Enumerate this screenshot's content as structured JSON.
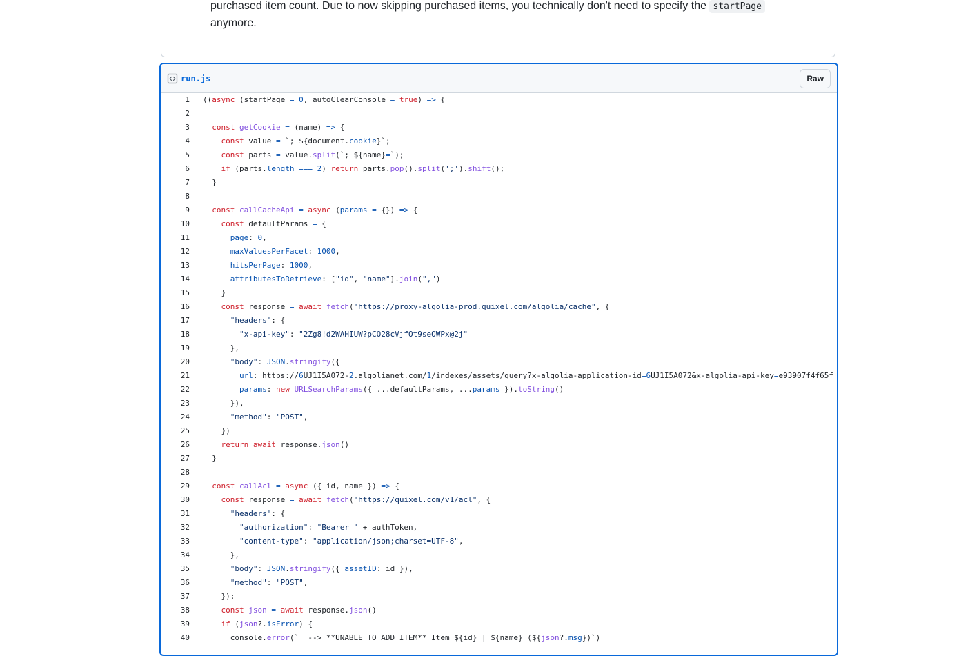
{
  "previous_comment": {
    "line1_text": "purchased item count. Due to now skipping purchased items, you technically don't need to specify the",
    "inline_code": "startPage",
    "line2_text": "anymore."
  },
  "file": {
    "icon": "code-square-icon",
    "name": "run.js",
    "raw_button": "Raw"
  },
  "colors": {
    "keyword": "#cf222e",
    "function": "#8250df",
    "constant": "#0550ae",
    "string": "#0a3069",
    "focus_border": "#0969da"
  },
  "code": [
    {
      "n": "1",
      "t": "((async (startPage = 0, autoClearConsole = true) => {"
    },
    {
      "n": "2",
      "t": ""
    },
    {
      "n": "3",
      "t": "  const getCookie = (name) => {"
    },
    {
      "n": "4",
      "t": "    const value = `; ${document.cookie}`;"
    },
    {
      "n": "5",
      "t": "    const parts = value.split(`; ${name}=`);"
    },
    {
      "n": "6",
      "t": "    if (parts.length === 2) return parts.pop().split(';').shift();"
    },
    {
      "n": "7",
      "t": "  }"
    },
    {
      "n": "8",
      "t": ""
    },
    {
      "n": "9",
      "t": "  const callCacheApi = async (params = {}) => {"
    },
    {
      "n": "10",
      "t": "    const defaultParams = {"
    },
    {
      "n": "11",
      "t": "      page: 0,"
    },
    {
      "n": "12",
      "t": "      maxValuesPerFacet: 1000,"
    },
    {
      "n": "13",
      "t": "      hitsPerPage: 1000,"
    },
    {
      "n": "14",
      "t": "      attributesToRetrieve: [\"id\", \"name\"].join(\",\")"
    },
    {
      "n": "15",
      "t": "    }"
    },
    {
      "n": "16",
      "t": "    const response = await fetch(\"https://proxy-algolia-prod.quixel.com/algolia/cache\", {"
    },
    {
      "n": "17",
      "t": "      \"headers\": {"
    },
    {
      "n": "18",
      "t": "        \"x-api-key\": \"2Zg8!d2WAHIUW?pCO28cVjfOt9seOWPx@2j\""
    },
    {
      "n": "19",
      "t": "      },"
    },
    {
      "n": "20",
      "t": "      \"body\": JSON.stringify({"
    },
    {
      "n": "21",
      "t": "        url: \"https://6UJ1I5A072-2.algolianet.com/1/indexes/assets/query?x-algolia-application-id=6UJ1I5A072&x-algolia-api-key=e93907f4f65f"
    },
    {
      "n": "22",
      "t": "        params: new URLSearchParams({ ...defaultParams, ...params }).toString()"
    },
    {
      "n": "23",
      "t": "      }),"
    },
    {
      "n": "24",
      "t": "      \"method\": \"POST\","
    },
    {
      "n": "25",
      "t": "    })"
    },
    {
      "n": "26",
      "t": "    return await response.json()"
    },
    {
      "n": "27",
      "t": "  }"
    },
    {
      "n": "28",
      "t": ""
    },
    {
      "n": "29",
      "t": "  const callAcl = async ({ id, name }) => {"
    },
    {
      "n": "30",
      "t": "    const response = await fetch(\"https://quixel.com/v1/acl\", {"
    },
    {
      "n": "31",
      "t": "      \"headers\": {"
    },
    {
      "n": "32",
      "t": "        \"authorization\": \"Bearer \" + authToken,"
    },
    {
      "n": "33",
      "t": "        \"content-type\": \"application/json;charset=UTF-8\","
    },
    {
      "n": "34",
      "t": "      },"
    },
    {
      "n": "35",
      "t": "      \"body\": JSON.stringify({ assetID: id }),"
    },
    {
      "n": "36",
      "t": "      \"method\": \"POST\","
    },
    {
      "n": "37",
      "t": "    });"
    },
    {
      "n": "38",
      "t": "    const json = await response.json()"
    },
    {
      "n": "39",
      "t": "    if (json?.isError) {"
    },
    {
      "n": "40",
      "t": "      console.error(`  --> **UNABLE TO ADD ITEM** Item ${id} | ${name} (${json?.msg})`)"
    }
  ]
}
